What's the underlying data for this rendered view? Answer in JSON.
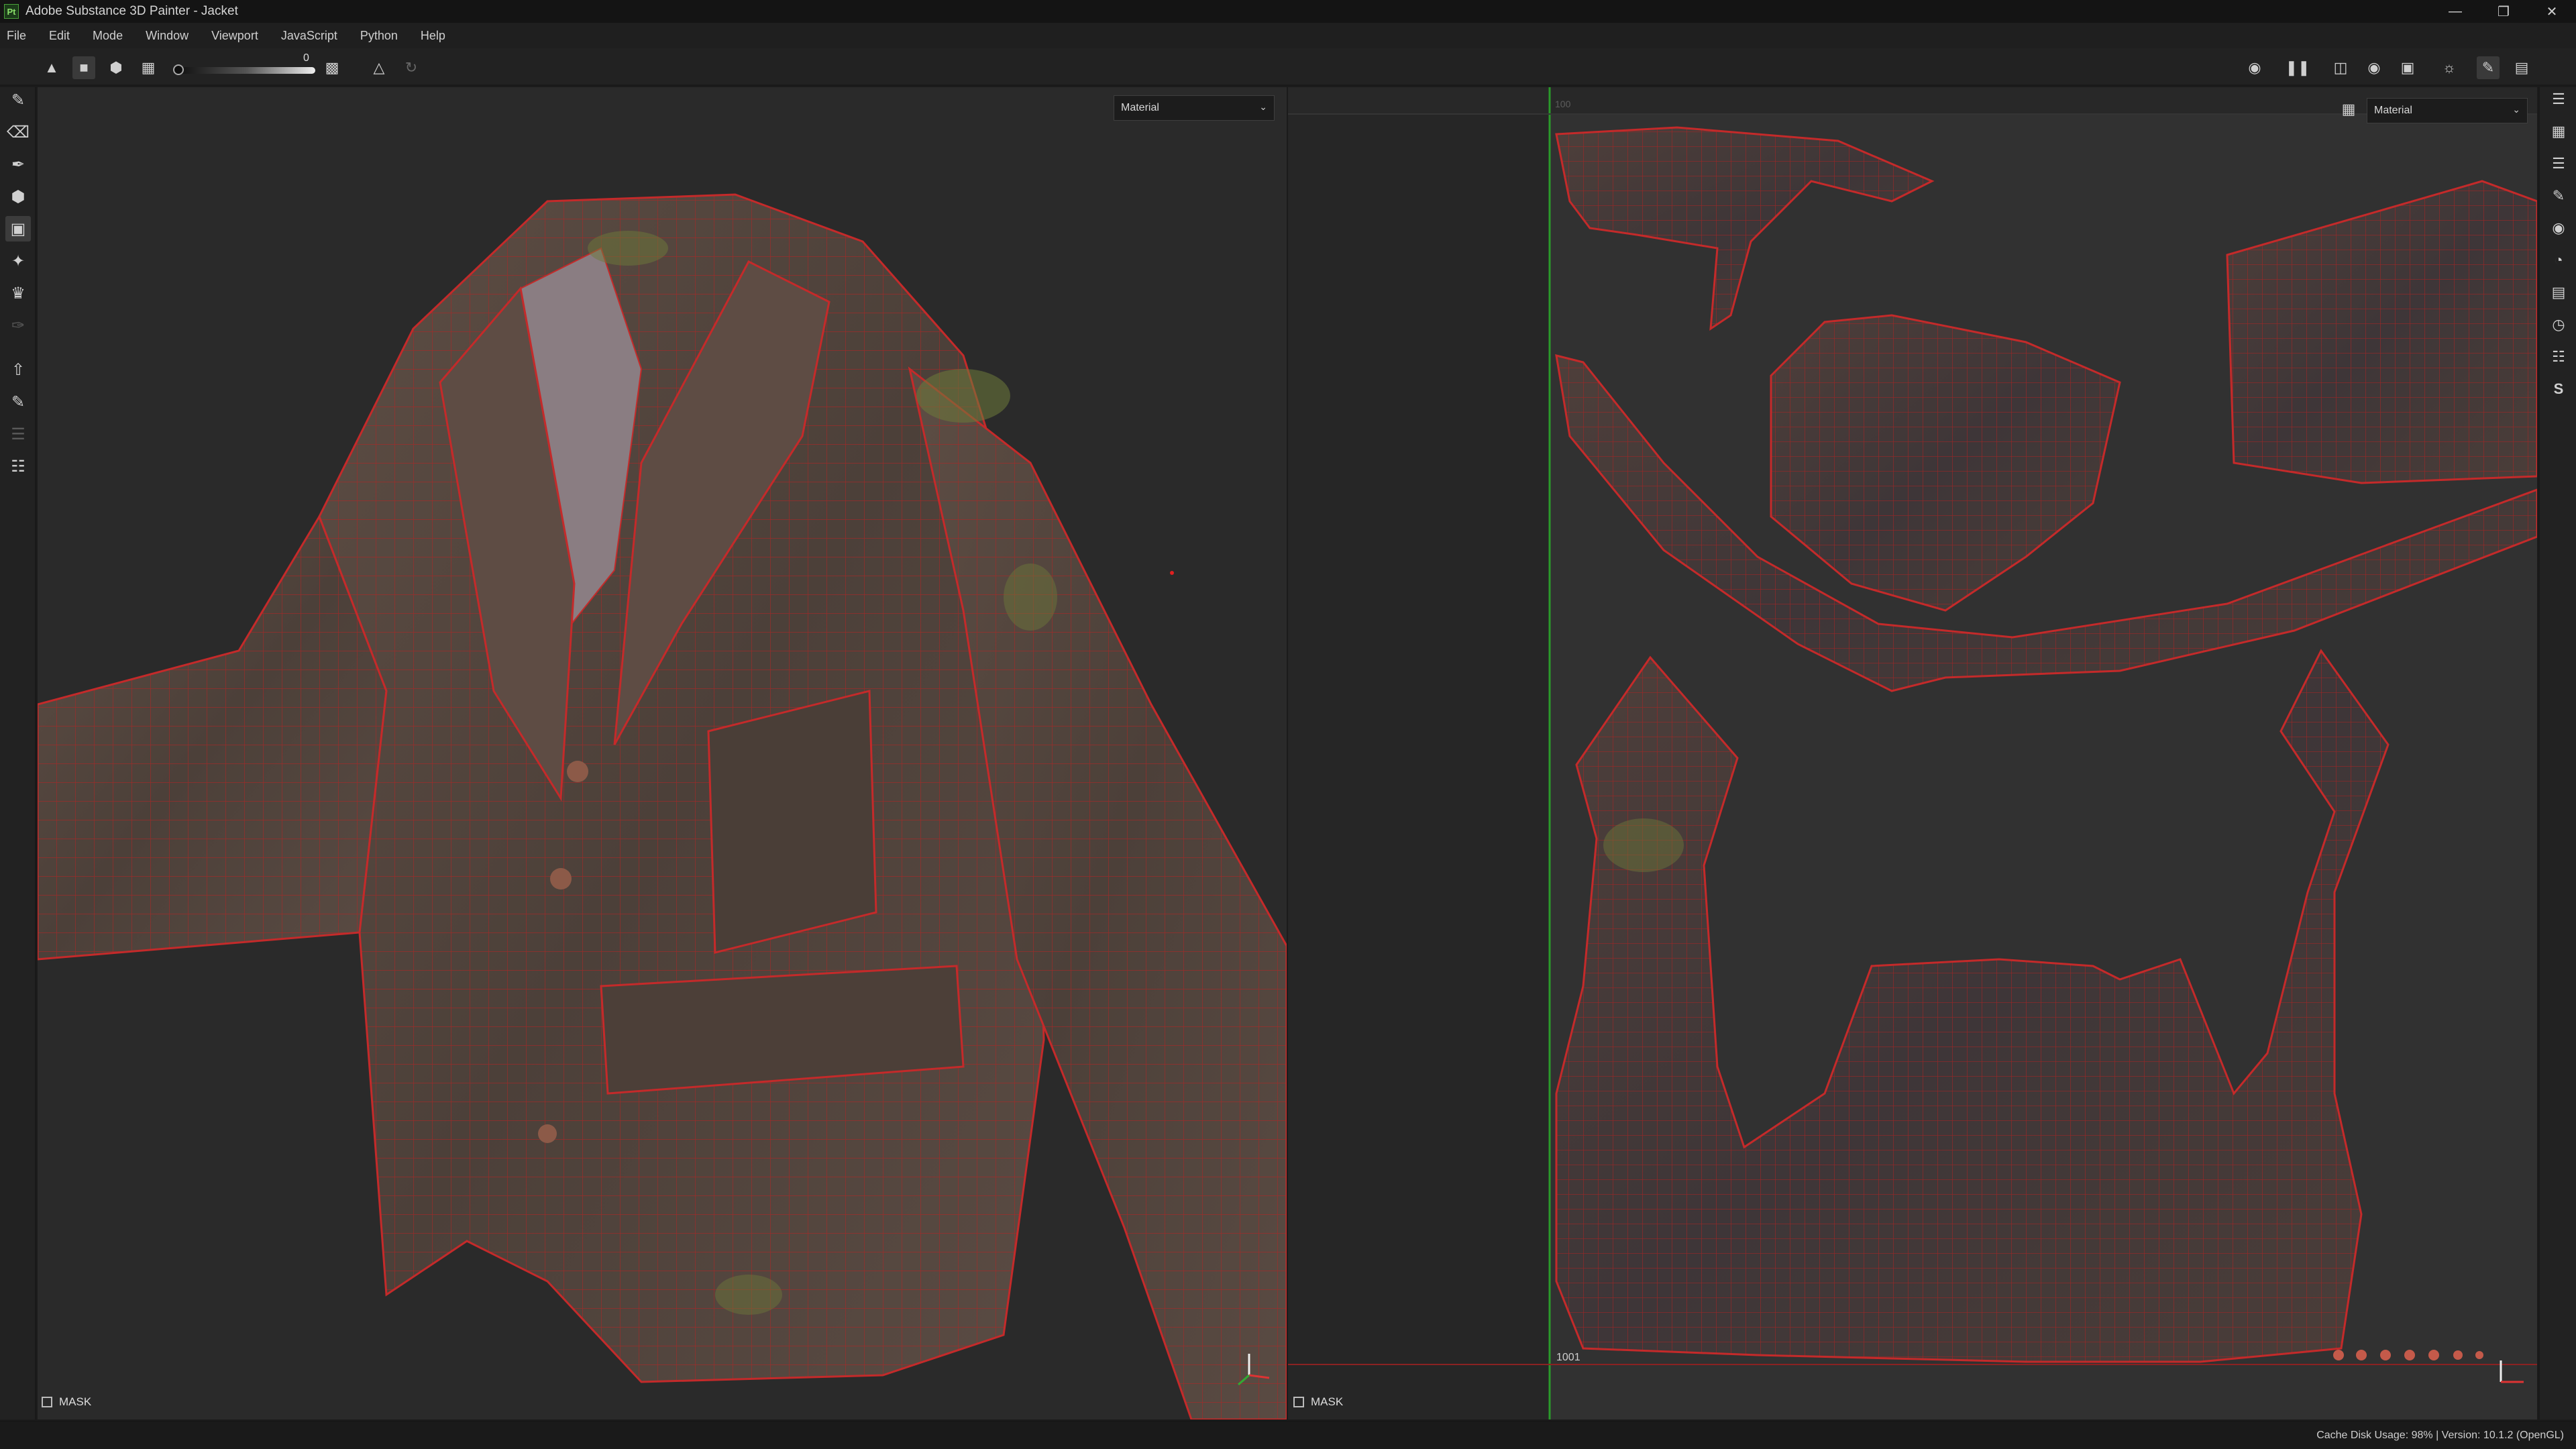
{
  "window": {
    "title": "Adobe Substance 3D Painter - Jacket",
    "logo_text": "Pt"
  },
  "menu": [
    "File",
    "Edit",
    "Mode",
    "Window",
    "Viewport",
    "JavaScript",
    "Python",
    "Help"
  ],
  "toolbar": {
    "brush_size_value": "0"
  },
  "viewport3d": {
    "channel": "Material",
    "mask_label": "MASK"
  },
  "viewport2d": {
    "channel": "Material",
    "mask_label": "MASK",
    "udim_tile": "1001",
    "tile_label_top": "100"
  },
  "status": {
    "text": "Cache Disk Usage:   98% | Version: 10.1.2 (OpenGL)"
  },
  "colors": {
    "accent": "#4aa23a",
    "wireframe": "#c42a2a",
    "uv_border": "#2a8a2a"
  }
}
